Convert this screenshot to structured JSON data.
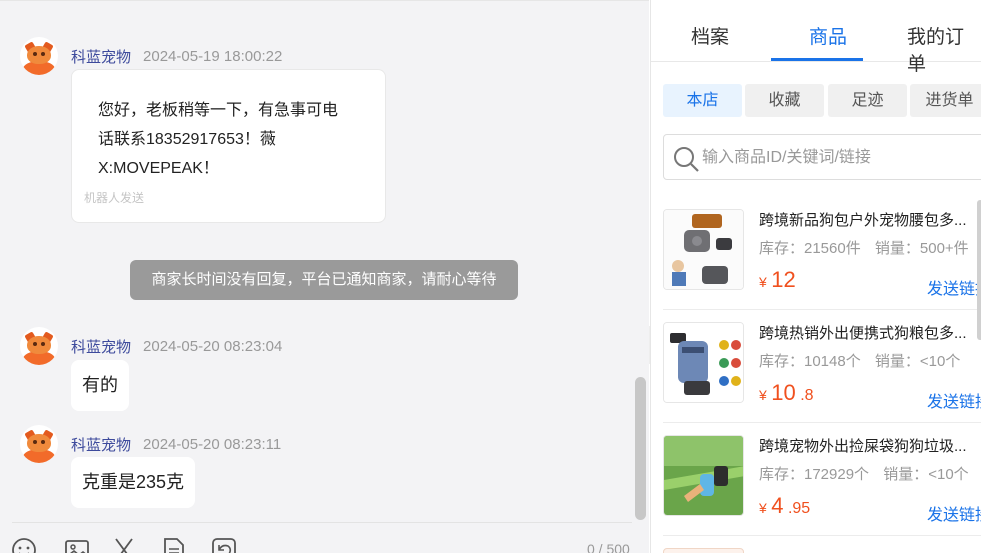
{
  "chat": {
    "messages": [
      {
        "sender": "科蓝宠物",
        "time": "2024-05-19 18:00:22",
        "lines": [
          "您好，老板稍等一下，有急事可电",
          "话联系18352917653！薇",
          "X:MOVEPEAK！"
        ],
        "note": "机器人发送"
      },
      {
        "sender": "科蓝宠物",
        "time": "2024-05-20 08:23:04",
        "text": "有的"
      },
      {
        "sender": "科蓝宠物",
        "time": "2024-05-20 08:23:11",
        "text": "克重是235克"
      }
    ],
    "system_notice": "商家长时间没有回复，平台已通知商家，请耐心等待",
    "tools": [
      "emoji-icon",
      "image-icon",
      "scissors-icon",
      "document-icon",
      "history-icon"
    ],
    "counter": "0 / 500",
    "collapse_glyph": "»"
  },
  "panel": {
    "tabs": [
      "档案",
      "商品",
      "我的订单"
    ],
    "active_tab": "商品",
    "subtabs": [
      "本店",
      "收藏",
      "足迹",
      "进货单"
    ],
    "active_subtab": "本店",
    "search_placeholder": "输入商品ID/关键词/链接",
    "products": [
      {
        "title": "跨境新品狗包户外宠物腰包多...",
        "stock": "库存：21560件",
        "sales": "销量：500+件",
        "currency": "¥",
        "price_int": "12",
        "price_dec": "",
        "send": "发送链接"
      },
      {
        "title": "跨境热销外出便携式狗粮包多...",
        "stock": "库存：10148个",
        "sales": "销量：<10个",
        "currency": "¥",
        "price_int": "10",
        "price_dec": ".8",
        "send": "发送链接"
      },
      {
        "title": "跨境宠物外出捡屎袋狗狗垃圾...",
        "stock": "库存：172929个",
        "sales": "销量：<10个",
        "currency": "¥",
        "price_int": "4",
        "price_dec": ".95",
        "send": "发送链接"
      }
    ]
  },
  "colors": {
    "accent": "#1a73e8",
    "price": "#f0501e",
    "sender": "#3d4a9c"
  }
}
